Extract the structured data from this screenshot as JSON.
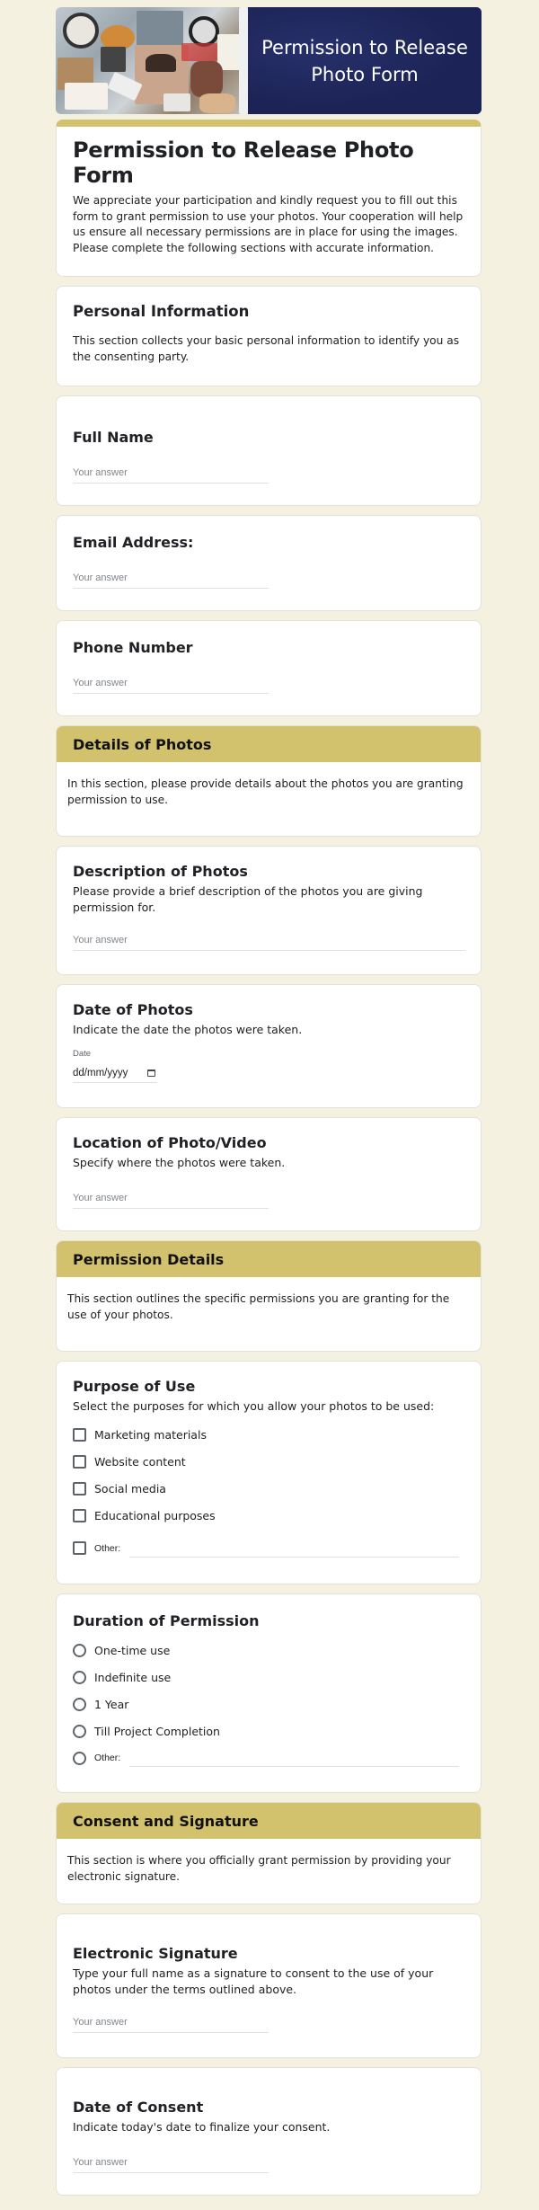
{
  "banner": {
    "title": "Permission to Release Photo Form",
    "image_alt": "photo-collage"
  },
  "intro": {
    "title": "Permission to Release Photo Form",
    "description": "We appreciate your participation and kindly request you to fill out this form to grant permission to use your photos. Your cooperation will help us ensure all necessary permissions are in place for using the images. Please complete the following sections with accurate information."
  },
  "personal_info": {
    "title": "Personal Information",
    "description": "This section collects your basic personal information to identify you as the consenting party."
  },
  "answer_placeholder": "Your answer",
  "questions": {
    "full_name": {
      "title": "Full Name"
    },
    "email": {
      "title": "Email Address:"
    },
    "phone": {
      "title": "Phone Number"
    },
    "description_of_photos": {
      "title": "Description of Photos",
      "description": "Please provide a brief description of the photos you are giving permission for."
    },
    "date_of_photos": {
      "title": "Date of Photos",
      "description": "Indicate the date the photos were taken.",
      "date_label": "Date",
      "date_placeholder": "dd/mm/yyyy"
    },
    "location": {
      "title": "Location of Photo/Video",
      "description": "Specify where the photos were taken."
    },
    "purpose": {
      "title": "Purpose of Use",
      "description": "Select the purposes for which you allow your photos to be used:",
      "options": [
        "Marketing materials",
        "Website content",
        "Social media",
        "Educational purposes"
      ],
      "other_label": "Other:"
    },
    "duration": {
      "title": "Duration of Permission",
      "options": [
        "One-time use",
        "Indefinite use",
        "1 Year",
        "Till Project Completion"
      ],
      "other_label": "Other:"
    },
    "signature": {
      "title": "Electronic Signature",
      "description": "Type your full name as a signature to consent to the use of your photos under the terms outlined above."
    },
    "date_of_consent": {
      "title": "Date of Consent",
      "description": "Indicate today's date to finalize your consent."
    }
  },
  "sections": {
    "details_of_photos": {
      "title": "Details of Photos",
      "description": "In this section, please provide details about the photos you are granting permission to use."
    },
    "permission_details": {
      "title": "Permission Details",
      "description": "This section outlines the specific permissions you are granting for the use of your photos."
    },
    "consent_signature": {
      "title": "Consent and Signature",
      "description": "This section is where you officially grant permission by providing your electronic signature."
    }
  },
  "colors": {
    "background": "#f5f1e1",
    "accent_gold": "#d2c26d",
    "banner_navy": "#1c2457"
  }
}
